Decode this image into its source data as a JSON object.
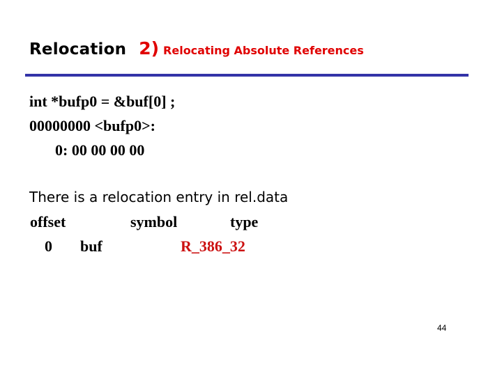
{
  "slide": {
    "title": {
      "main": "Relocation",
      "number": "2)",
      "subtitle": "Relocating Absolute References"
    },
    "code_lines": [
      "int *bufp0 = &buf[0] ;",
      "00000000 <bufp0>:",
      "0: 00 00 00 00"
    ],
    "statement": "There is a relocation entry in rel.data",
    "relocation_table": {
      "headers": [
        "offset",
        "symbol",
        "type"
      ],
      "rows": [
        {
          "offset": "0",
          "symbol": "buf",
          "type": "R_386_32"
        }
      ]
    },
    "page_number": "44",
    "colors": {
      "accent_red": "#e00000",
      "rule_blue": "#3333a8",
      "type_red": "#cc1111"
    }
  }
}
